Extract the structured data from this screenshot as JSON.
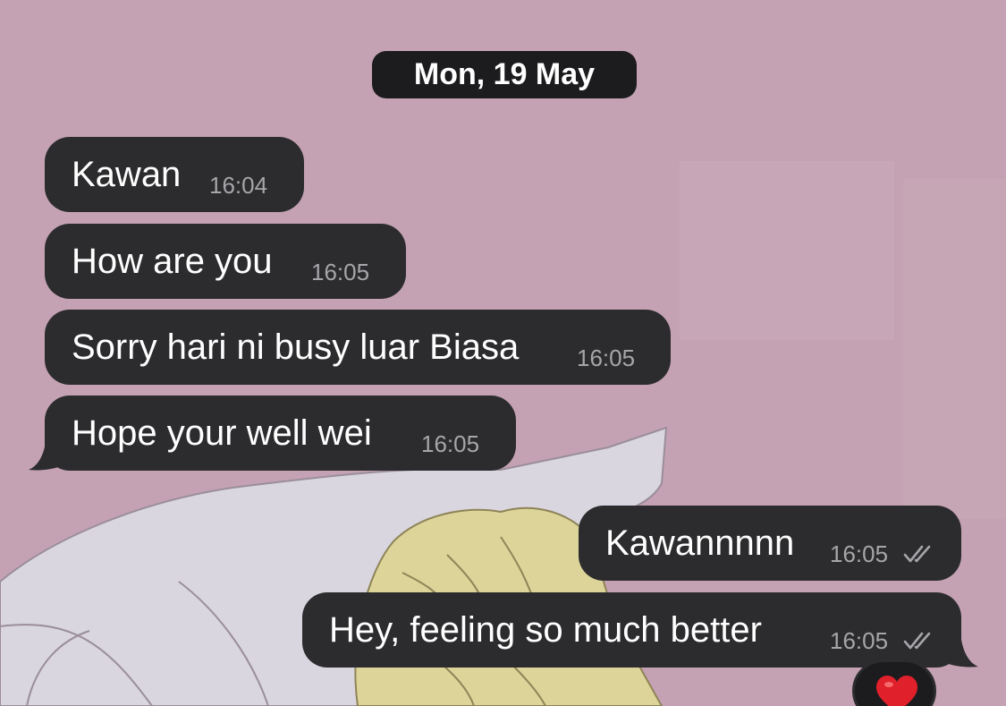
{
  "conversation": {
    "date_label": "Mon, 19 May",
    "incoming": [
      {
        "text": "Kawan",
        "time": "16:04"
      },
      {
        "text": "How are you",
        "time": "16:05"
      },
      {
        "text": "Sorry hari ni busy luar Biasa",
        "time": "16:05"
      },
      {
        "text": "Hope your well wei",
        "time": "16:05"
      }
    ],
    "outgoing": [
      {
        "text": "Kawannnnn",
        "time": "16:05",
        "status": "read"
      },
      {
        "text": "Hey, feeling so much better",
        "time": "16:05",
        "status": "read"
      }
    ],
    "reaction": {
      "emoji": "heart",
      "icon": "red-heart-icon"
    }
  },
  "colors": {
    "wallpaper": "#c4a2b3",
    "bubble": "#2c2c2e",
    "date_pill": "#1c1c1e",
    "timestamp": "#a6a6aa",
    "heart": "#e0202a"
  }
}
